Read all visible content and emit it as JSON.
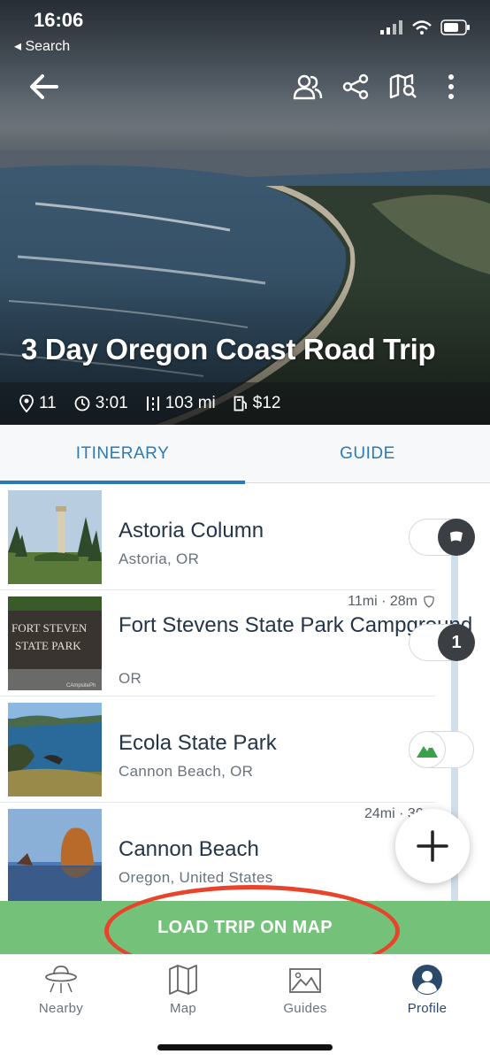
{
  "status_bar": {
    "time": "16:06",
    "back_label": "◂ Search"
  },
  "header": {
    "title": "3 Day Oregon Coast Road Trip",
    "icons": [
      "back-arrow-icon",
      "travelers-icon",
      "share-icon",
      "map-search-icon",
      "more-icon"
    ]
  },
  "stats": {
    "stops": "11",
    "duration": "3:01",
    "distance": "103 mi",
    "fuel_cost": "$12"
  },
  "tabs": [
    {
      "label": "ITINERARY",
      "active": true
    },
    {
      "label": "GUIDE",
      "active": false
    }
  ],
  "stops": [
    {
      "name": "Astoria Column",
      "location": "Astoria, OR",
      "leg": "",
      "marker": "flag"
    },
    {
      "name": "Fort Stevens State Park Campground",
      "location": "OR",
      "leg": "11mi · 28m",
      "marker": "1",
      "sign_text": "FORT STEVENS STATE PARK",
      "photo_credit": "CAmpsitePhotos"
    },
    {
      "name": "Ecola State Park",
      "location": "Cannon Beach, OR",
      "leg": "",
      "marker": "park"
    },
    {
      "name": "Cannon Beach",
      "location": "Oregon, United States",
      "leg": "24mi · 36m",
      "marker": ""
    }
  ],
  "load_button": "LOAD TRIP ON MAP",
  "bottom_nav": [
    {
      "label": "Nearby",
      "icon": "ufo-icon",
      "active": false
    },
    {
      "label": "Map",
      "icon": "map-icon",
      "active": false
    },
    {
      "label": "Guides",
      "icon": "photo-icon",
      "active": false
    },
    {
      "label": "Profile",
      "icon": "avatar-icon",
      "active": true
    }
  ],
  "colors": {
    "accent": "#2a7ab8",
    "load_button": "#74c27a",
    "annotation": "#e8442c",
    "park_green": "#3aa04a"
  }
}
